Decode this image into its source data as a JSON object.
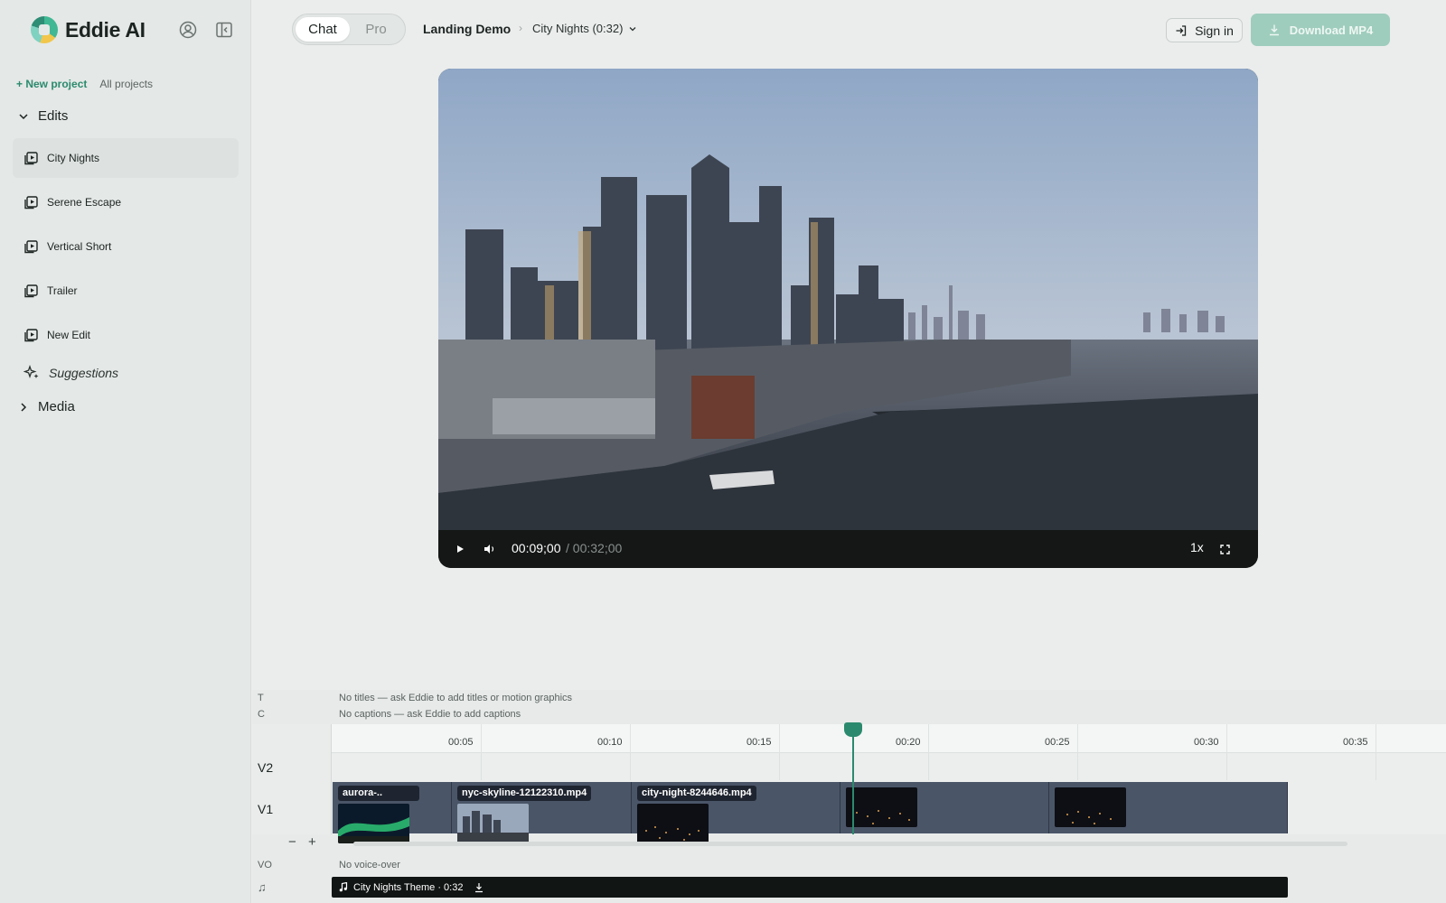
{
  "brand": {
    "name": "Eddie AI"
  },
  "sidebar": {
    "new_project": "+ New project",
    "all_projects": "All projects",
    "edits_label": "Edits",
    "items": [
      {
        "label": "City Nights",
        "active": true
      },
      {
        "label": "Serene Escape"
      },
      {
        "label": "Vertical Short"
      },
      {
        "label": "Trailer"
      },
      {
        "label": "New Edit"
      }
    ],
    "suggestions": "Suggestions",
    "media_label": "Media"
  },
  "header": {
    "mode_tabs": [
      "Chat",
      "Pro"
    ],
    "active_mode": "Chat",
    "project": "Landing Demo",
    "edit_selector": "City Nights (0:32)",
    "signin": "Sign in",
    "download": "Download MP4"
  },
  "player": {
    "current_time": "00:09;00",
    "total_time": "/ 00:32;00",
    "speed": "1x"
  },
  "timeline": {
    "titles_track": {
      "label": "T",
      "note": "No titles — ask Eddie to add titles or motion graphics"
    },
    "captions_track": {
      "label": "C",
      "note": "No captions — ask Eddie to add captions"
    },
    "ticks": [
      "00:05",
      "00:10",
      "00:15",
      "00:20",
      "00:25",
      "00:30",
      "00:35"
    ],
    "v2_label": "V2",
    "v1_label": "V1",
    "clips": [
      {
        "name": "aurora-.."
      },
      {
        "name": "nyc-skyline-12122310.mp4"
      },
      {
        "name": "city-night-8244646.mp4"
      },
      {
        "name": ""
      },
      {
        "name": ""
      }
    ],
    "zoom_out": "−",
    "zoom_in": "+",
    "vo_track": {
      "label": "VO",
      "note": "No voice-over"
    },
    "music_track": {
      "label": "♫",
      "title": "City Nights Theme · 0:32"
    },
    "playhead_seconds": 9
  },
  "colors": {
    "accent": "#2b8a6d",
    "download_bg": "#9fcdbd",
    "clip_bg": "#4a5568"
  }
}
